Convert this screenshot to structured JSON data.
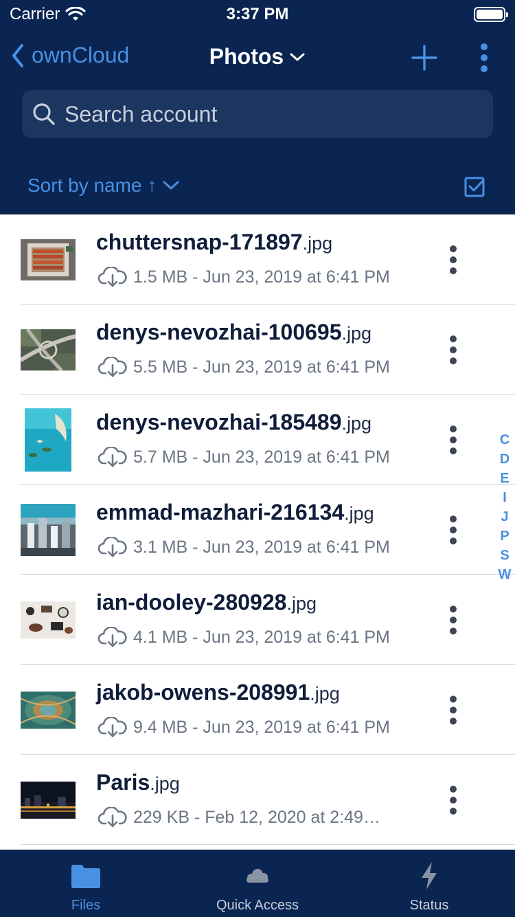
{
  "status_bar": {
    "carrier": "Carrier",
    "time": "3:37 PM"
  },
  "nav": {
    "back_label": "ownCloud",
    "title": "Photos"
  },
  "search": {
    "placeholder": "Search account"
  },
  "sort": {
    "label": "Sort by name ↑"
  },
  "files": [
    {
      "name": "chuttersnap-171897",
      "ext": ".jpg",
      "meta": "1.5 MB - Jun 23, 2019 at 6:41 PM",
      "thumb": "overhead-food"
    },
    {
      "name": "denys-nevozhai-100695",
      "ext": ".jpg",
      "meta": "5.5 MB - Jun 23, 2019 at 6:41 PM",
      "thumb": "highway"
    },
    {
      "name": "denys-nevozhai-185489",
      "ext": ".jpg",
      "meta": "5.7 MB - Jun 23, 2019 at 6:41 PM",
      "thumb": "ocean"
    },
    {
      "name": "emmad-mazhari-216134",
      "ext": ".jpg",
      "meta": "3.1 MB - Jun 23, 2019 at 6:41 PM",
      "thumb": "city"
    },
    {
      "name": "ian-dooley-280928",
      "ext": ".jpg",
      "meta": "4.1 MB - Jun 23, 2019 at 6:41 PM",
      "thumb": "flatlay"
    },
    {
      "name": "jakob-owens-208991",
      "ext": ".jpg",
      "meta": "9.4 MB - Jun 23, 2019 at 6:41 PM",
      "thumb": "tunnel"
    },
    {
      "name": "Paris",
      "ext": ".jpg",
      "meta": "229 KB - Feb 12, 2020 at 2:49…",
      "thumb": "night"
    }
  ],
  "index_letters": [
    "C",
    "D",
    "E",
    "I",
    "J",
    "P",
    "S",
    "W"
  ],
  "tabs": [
    {
      "label": "Files",
      "icon": "folder-icon",
      "active": true
    },
    {
      "label": "Quick Access",
      "icon": "cloud-icon",
      "active": false
    },
    {
      "label": "Status",
      "icon": "lightning-icon",
      "active": false
    }
  ],
  "colors": {
    "header_bg": "#0a2552",
    "accent": "#4a90e2",
    "search_bg": "#1c3660"
  }
}
